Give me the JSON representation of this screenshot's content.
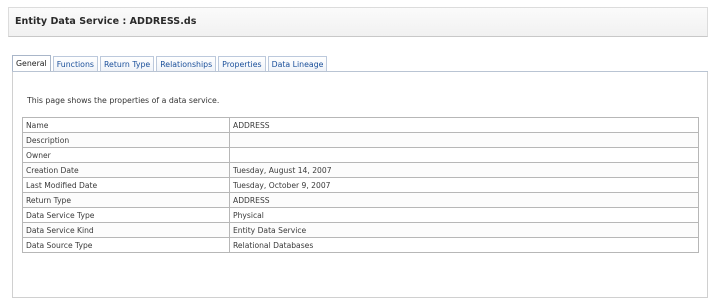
{
  "window": {
    "title": "Entity Data Service : ADDRESS.ds"
  },
  "tabs": [
    {
      "label": "General",
      "active": true
    },
    {
      "label": "Functions",
      "active": false
    },
    {
      "label": "Return Type",
      "active": false
    },
    {
      "label": "Relationships",
      "active": false
    },
    {
      "label": "Properties",
      "active": false
    },
    {
      "label": "Data Lineage",
      "active": false
    }
  ],
  "general": {
    "intro": "This page shows the properties of a data service.",
    "properties": [
      {
        "name": "Name",
        "value": "ADDRESS"
      },
      {
        "name": "Description",
        "value": ""
      },
      {
        "name": "Owner",
        "value": ""
      },
      {
        "name": "Creation Date",
        "value": "Tuesday, August 14, 2007"
      },
      {
        "name": "Last Modified Date",
        "value": "Tuesday, October 9, 2007"
      },
      {
        "name": "Return Type",
        "value": "ADDRESS"
      },
      {
        "name": "Data Service Type",
        "value": "Physical"
      },
      {
        "name": "Data Service Kind",
        "value": "Entity Data Service"
      },
      {
        "name": "Data Source Type",
        "value": "Relational Databases"
      }
    ]
  },
  "colors": {
    "tab_link": "#1a4f9a",
    "table_border": "#b7b7b7"
  }
}
